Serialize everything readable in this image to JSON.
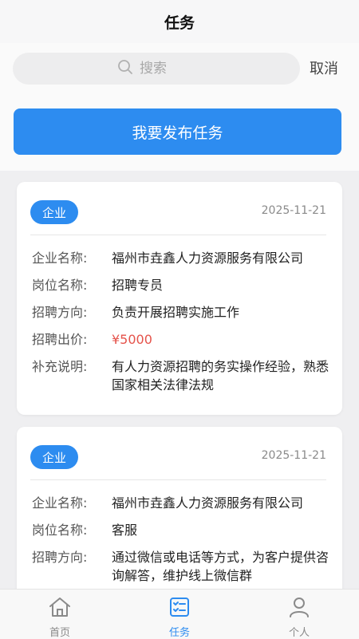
{
  "header": {
    "title": "任务"
  },
  "search": {
    "placeholder": "搜索",
    "cancel_label": "取消"
  },
  "publish_button": "我要发布任务",
  "labels": {
    "company": "企业名称:",
    "position": "岗位名称:",
    "direction": "招聘方向:",
    "price": "招聘出价:",
    "note": "补充说明:"
  },
  "cards": [
    {
      "badge": "企业",
      "date": "2025-11-21",
      "company": "福州市垚鑫人力资源服务有限公司",
      "position": "招聘专员",
      "direction": "负责开展招聘实施工作",
      "price": "¥5000",
      "note": "有人力资源招聘的务实操作经验，熟悉国家相关法律法规"
    },
    {
      "badge": "企业",
      "date": "2025-11-21",
      "company": "福州市垚鑫人力资源服务有限公司",
      "position": "客服",
      "direction": "通过微信或电话等方式，为客户提供咨询解答，维护线上微信群"
    }
  ],
  "tabbar": [
    {
      "label": "首页",
      "icon": "home-icon",
      "active": false
    },
    {
      "label": "任务",
      "icon": "task-list-icon",
      "active": true
    },
    {
      "label": "个人",
      "icon": "user-icon",
      "active": false
    }
  ],
  "colors": {
    "accent": "#2d8cf0",
    "price": "#e5534b"
  }
}
